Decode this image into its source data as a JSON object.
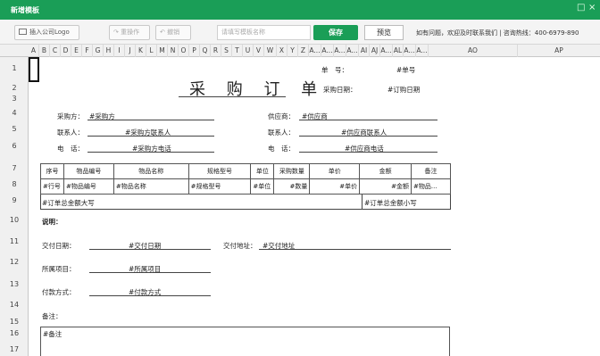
{
  "window": {
    "title": "新增模板",
    "restore_symbol": "□",
    "close_symbol": "×"
  },
  "toolbar": {
    "insert_logo": "插入公司Logo",
    "redo": "重操作",
    "undo": "撤销",
    "template_name_placeholder": "请填写模板名称",
    "save": "保存",
    "preview": "预览",
    "hotline": "如有问题，欢迎及时联系我们 | 咨询热线：400-6979-890"
  },
  "columns": [
    "A",
    "B",
    "C",
    "D",
    "E",
    "F",
    "G",
    "H",
    "I",
    "J",
    "K",
    "L",
    "M",
    "N",
    "O",
    "P",
    "Q",
    "R",
    "S",
    "T",
    "U",
    "V",
    "W",
    "X",
    "Y",
    "Z",
    "A...",
    "A...",
    "A...",
    "A...",
    "AI",
    "AJ",
    "A...",
    "AL",
    "A...",
    "A...",
    "AO",
    "AP"
  ],
  "rows": [
    "1",
    "2",
    "3",
    "4",
    "5",
    "6",
    "7",
    "8",
    "9",
    "10",
    "11",
    "12",
    "13",
    "14",
    "15",
    "16",
    "17"
  ],
  "sheet": {
    "title": "采 购 订 单",
    "order_no_label": "单　号：",
    "order_no_value": "#单号",
    "order_date_label": "采购日期：",
    "order_date_value": "#订购日期",
    "buyer_label": "采购方：",
    "buyer_value": "#采购方",
    "supplier_label": "供应商：",
    "supplier_value": "#供应商",
    "buyer_contact_label": "联系人：",
    "buyer_contact_value": "#采购方联系人",
    "supplier_contact_label": "联系人：",
    "supplier_contact_value": "#供应商联系人",
    "buyer_phone_label": "电　话：",
    "buyer_phone_value": "#采购方电话",
    "supplier_phone_label": "电　话：",
    "supplier_phone_value": "#供应商电话",
    "table_headers": [
      "序号",
      "物品编号",
      "物品名称",
      "规格型号",
      "单位",
      "采购数量",
      "单价",
      "金额",
      "备注"
    ],
    "table_row": [
      "#行号",
      "#物品编号",
      "#物品名称",
      "#规格型号",
      "#单位",
      "#数量",
      "#单价",
      "#金额",
      "#物品..."
    ],
    "total_upper": "#订单总金额大写",
    "total_lower": "#订单总金额小写",
    "notes_heading": "说明：",
    "delivery_date_label": "交付日期：",
    "delivery_date_value": "#交付日期",
    "delivery_addr_label": "交付地址：",
    "delivery_addr_value": "#交付地址",
    "project_label": "所属项目：",
    "project_value": "#所属项目",
    "payment_label": "付款方式：",
    "payment_value": "#付款方式",
    "remarks_label": "备注：",
    "remarks_value": "#备注"
  },
  "colors": {
    "accent": "#1a9e57"
  }
}
